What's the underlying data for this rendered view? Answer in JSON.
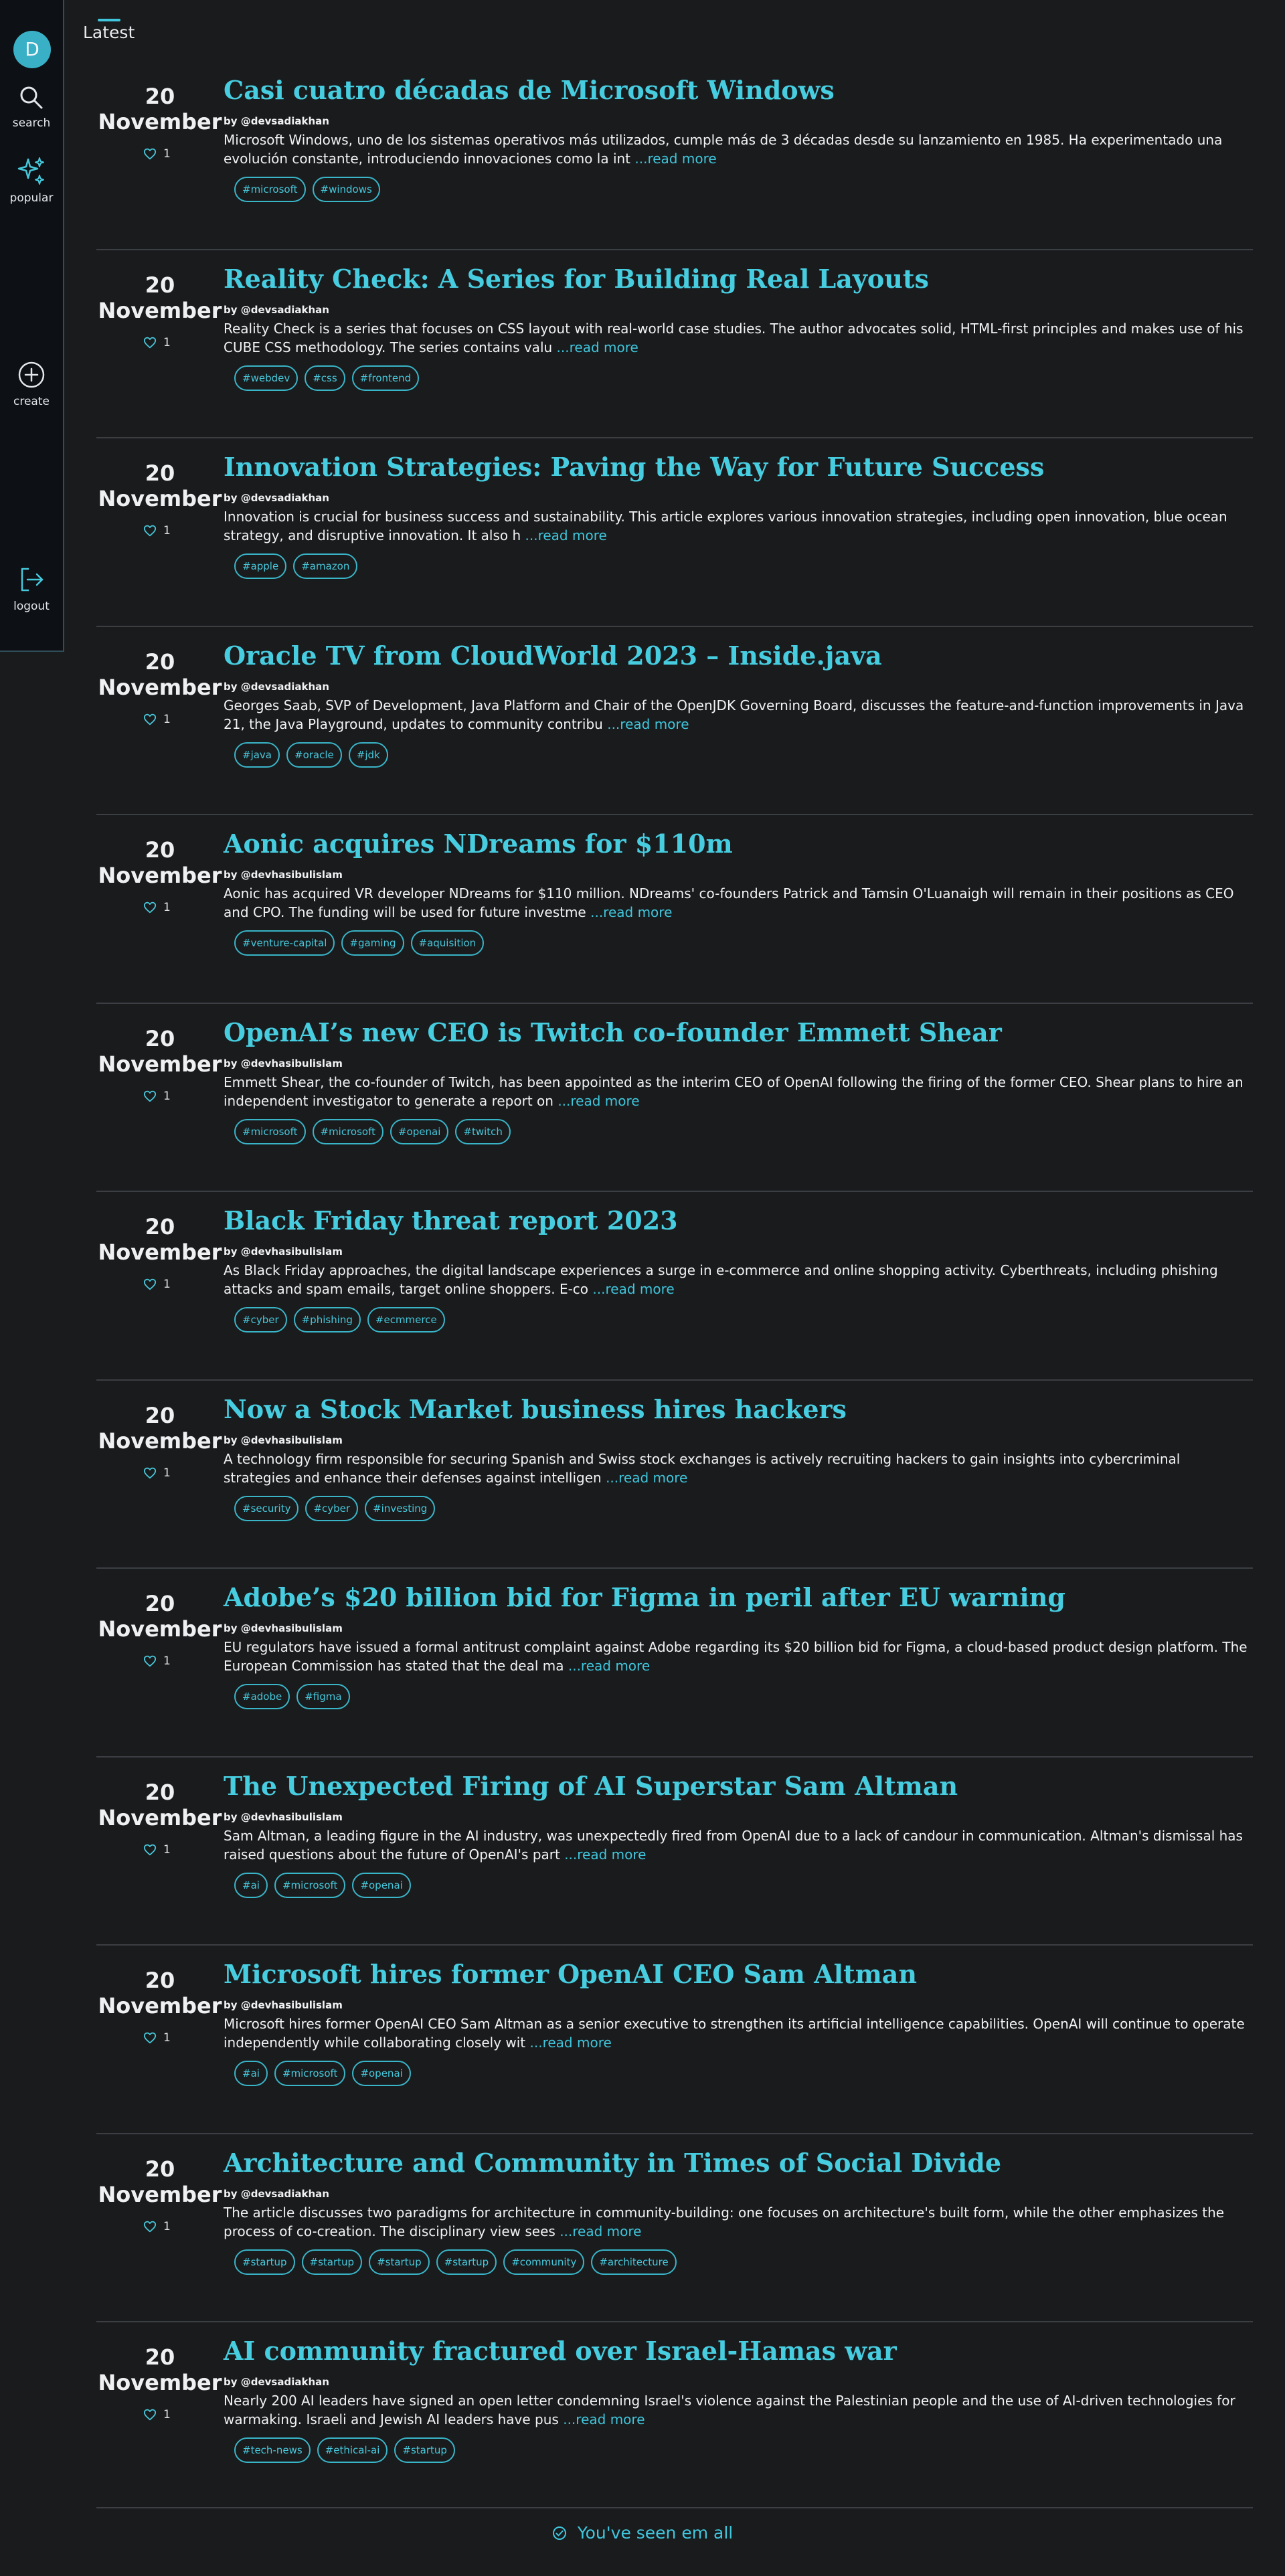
{
  "sidebar": {
    "avatar_letter": "D",
    "search_label": "search",
    "popular_label": "popular",
    "create_label": "create",
    "logout_label": "logout"
  },
  "feed": {
    "tab_label": "Latest",
    "end_message": "You've seen em all"
  },
  "read_more_label": "...read more",
  "articles": [
    {
      "day": "20",
      "month": "November",
      "likes": "1",
      "title": "Casi cuatro décadas de Microsoft Windows",
      "author": "by @devsadiakhan",
      "excerpt": "Microsoft Windows, uno de los sistemas operativos más utilizados, cumple más de 3 décadas desde su lanzamiento en 1985. Ha experimentado una evolución constante, introduciendo innovaciones como la int",
      "tags": [
        "#microsoft",
        "#windows"
      ]
    },
    {
      "day": "20",
      "month": "November",
      "likes": "1",
      "title": "Reality Check: A Series for Building Real Layouts",
      "author": "by @devsadiakhan",
      "excerpt": "Reality Check is a series that focuses on CSS layout with real-world case studies. The author advocates solid, HTML-first principles and makes use of his CUBE CSS methodology. The series contains valu",
      "tags": [
        "#webdev",
        "#css",
        "#frontend"
      ]
    },
    {
      "day": "20",
      "month": "November",
      "likes": "1",
      "title": "Innovation Strategies: Paving the Way for Future Success",
      "author": "by @devsadiakhan",
      "excerpt": "Innovation is crucial for business success and sustainability. This article explores various innovation strategies, including open innovation, blue ocean strategy, and disruptive innovation. It also h",
      "tags": [
        "#apple",
        "#amazon"
      ]
    },
    {
      "day": "20",
      "month": "November",
      "likes": "1",
      "title": "Oracle TV from CloudWorld 2023 – Inside.java",
      "author": "by @devsadiakhan",
      "excerpt": "Georges Saab, SVP of Development, Java Platform and Chair of the OpenJDK Governing Board, discusses the feature-and-function improvements in Java 21, the Java Playground, updates to community contribu",
      "tags": [
        "#java",
        "#oracle",
        "#jdk"
      ]
    },
    {
      "day": "20",
      "month": "November",
      "likes": "1",
      "title": "Aonic acquires NDreams for $110m",
      "author": "by @devhasibulislam",
      "excerpt": "Aonic has acquired VR developer NDreams for $110 million. NDreams' co-founders Patrick and Tamsin O'Luanaigh will remain in their positions as CEO and CPO. The funding will be used for future investme",
      "tags": [
        "#venture-capital",
        "#gaming",
        "#aquisition"
      ]
    },
    {
      "day": "20",
      "month": "November",
      "likes": "1",
      "title": "OpenAI’s new CEO is Twitch co-founder Emmett Shear",
      "author": "by @devhasibulislam",
      "excerpt": "Emmett Shear, the co-founder of Twitch, has been appointed as the interim CEO of OpenAI following the firing of the former CEO. Shear plans to hire an independent investigator to generate a report on",
      "tags": [
        "#microsoft",
        "#microsoft",
        "#openai",
        "#twitch"
      ]
    },
    {
      "day": "20",
      "month": "November",
      "likes": "1",
      "title": "Black Friday threat report 2023",
      "author": "by @devhasibulislam",
      "excerpt": "As Black Friday approaches, the digital landscape experiences a surge in e-commerce and online shopping activity. Cyberthreats, including phishing attacks and spam emails, target online shoppers. E-co",
      "tags": [
        "#cyber",
        "#phishing",
        "#ecmmerce"
      ]
    },
    {
      "day": "20",
      "month": "November",
      "likes": "1",
      "title": "Now a Stock Market business hires hackers",
      "author": "by @devhasibulislam",
      "excerpt": "A technology firm responsible for securing Spanish and Swiss stock exchanges is actively recruiting hackers to gain insights into cybercriminal strategies and enhance their defenses against intelligen",
      "tags": [
        "#security",
        "#cyber",
        "#investing"
      ]
    },
    {
      "day": "20",
      "month": "November",
      "likes": "1",
      "title": "Adobe’s $20 billion bid for Figma in peril after EU warning",
      "author": "by @devhasibulislam",
      "excerpt": "EU regulators have issued a formal antitrust complaint against Adobe regarding its $20 billion bid for Figma, a cloud-based product design platform. The European Commission has stated that the deal ma",
      "tags": [
        "#adobe",
        "#figma"
      ]
    },
    {
      "day": "20",
      "month": "November",
      "likes": "1",
      "title": "The Unexpected Firing of AI Superstar Sam Altman",
      "author": "by @devhasibulislam",
      "excerpt": "Sam Altman, a leading figure in the AI industry, was unexpectedly fired from OpenAI due to a lack of candour in communication. Altman's dismissal has raised questions about the future of OpenAI's part",
      "tags": [
        "#ai",
        "#microsoft",
        "#openai"
      ]
    },
    {
      "day": "20",
      "month": "November",
      "likes": "1",
      "title": "Microsoft hires former OpenAI CEO Sam Altman",
      "author": "by @devhasibulislam",
      "excerpt": "Microsoft hires former OpenAI CEO Sam Altman as a senior executive to strengthen its artificial intelligence capabilities. OpenAI will continue to operate independently while collaborating closely wit",
      "tags": [
        "#ai",
        "#microsoft",
        "#openai"
      ]
    },
    {
      "day": "20",
      "month": "November",
      "likes": "1",
      "title": "Architecture and Community in Times of Social Divide",
      "author": "by @devsadiakhan",
      "excerpt": "The article discusses two paradigms for architecture in community-building: one focuses on architecture's built form, while the other emphasizes the process of co-creation. The disciplinary view sees",
      "tags": [
        "#startup",
        "#startup",
        "#startup",
        "#startup",
        "#community",
        "#architecture"
      ]
    },
    {
      "day": "20",
      "month": "November",
      "likes": "1",
      "title": "AI community fractured over Israel-Hamas war",
      "author": "by @devsadiakhan",
      "excerpt": "Nearly 200 AI leaders have signed an open letter condemning Israel's violence against the Palestinian people and the use of AI-driven technologies for warmaking. Israeli and Jewish AI leaders have pus",
      "tags": [
        "#tech-news",
        "#ethical-ai",
        "#startup"
      ]
    }
  ]
}
